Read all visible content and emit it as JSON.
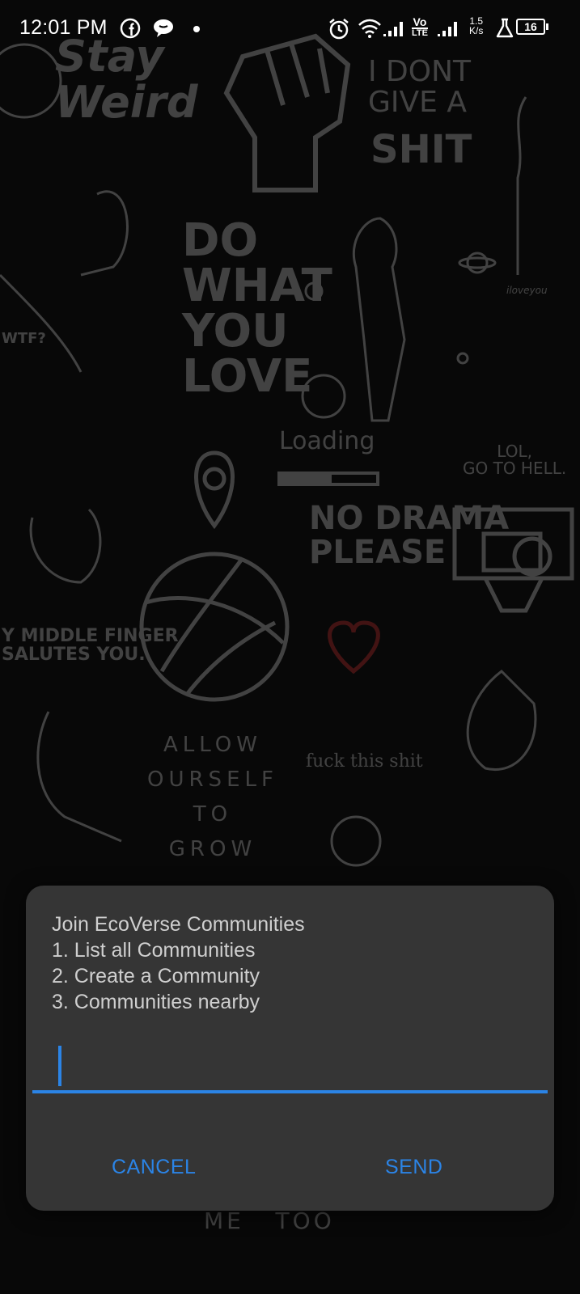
{
  "status_bar": {
    "time": "12:01 PM",
    "network_speed_value": "1.5",
    "network_speed_unit": "K/s",
    "volte_top": "Vo",
    "volte_bottom": "LTE",
    "battery_level": "16",
    "icons": [
      "facebook-icon",
      "chat-bubble-icon",
      "notification-dot-icon",
      "alarm-icon",
      "wifi-icon",
      "signal-icon",
      "volte-icon",
      "signal-icon",
      "network-speed-icon",
      "flask-icon",
      "battery-icon"
    ]
  },
  "wallpaper": {
    "stay_weird": "Stay\nWeird",
    "dont_give": "I DONT\nGIVE A",
    "shit": "SHIT",
    "do_what": "DO\nWHAT\nYOU\nLOVE",
    "loading": "Loading",
    "lol": "LOL,\nGO TO HELL.",
    "no_drama": "NO DRAMA\nPLEASE",
    "wtf": "WTF?",
    "middle_finger": "Y MIDDLE FINGER\nSALUTES YOU.",
    "allow": "ALLOW\nOURSELF\nTO\nGROW",
    "fuck_this": "fuck this shit",
    "me_too": "ME   TOO",
    "i_love_you": "iloveyou"
  },
  "dialog": {
    "message_lines": [
      "Join EcoVerse Communities",
      "1. List all Communities",
      "2. Create a Community",
      "3. Communities nearby"
    ],
    "input_value": "",
    "input_placeholder": "",
    "cancel_label": "CANCEL",
    "send_label": "SEND"
  },
  "colors": {
    "accent": "#2b84e6",
    "dialog_bg": "#353535",
    "dialog_text": "#cfcfcf"
  }
}
